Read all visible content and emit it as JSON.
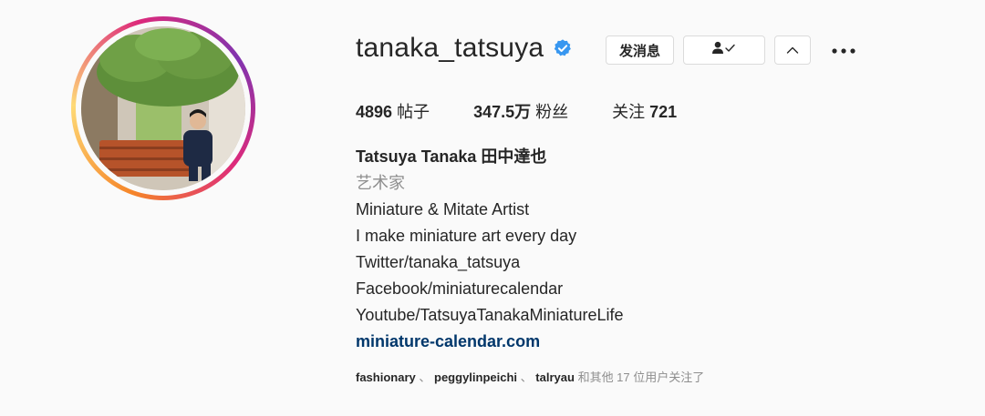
{
  "profile": {
    "username": "tanaka_tatsuya",
    "verified": true,
    "verified_color": "#3897f0",
    "avatar_alt": "avatar"
  },
  "actions": {
    "message_label": "发消息",
    "follow_icon": "person-check-icon",
    "more_icon": "chevron-up-icon",
    "options_icon": "more-horizontal-icon"
  },
  "stats": {
    "posts_value": "4896",
    "posts_label": "帖子",
    "followers_value": "347.5万",
    "followers_label": "粉丝",
    "following_label": "关注",
    "following_value": "721"
  },
  "bio": {
    "full_name": "Tatsuya Tanaka 田中達也",
    "category": "艺术家",
    "lines": [
      "Miniature & Mitate Artist",
      "I make miniature art every day",
      "Twitter/tanaka_tatsuya",
      "Facebook/miniaturecalendar",
      "Youtube/TatsuyaTanakaMiniatureLife"
    ],
    "website": "miniature-calendar.com",
    "link_color": "#00376b"
  },
  "followed_by": {
    "users": [
      "fashionary",
      "peggylinpeichi",
      "talryau"
    ],
    "separator": "、",
    "suffix": "和其他 17 位用户关注了"
  }
}
